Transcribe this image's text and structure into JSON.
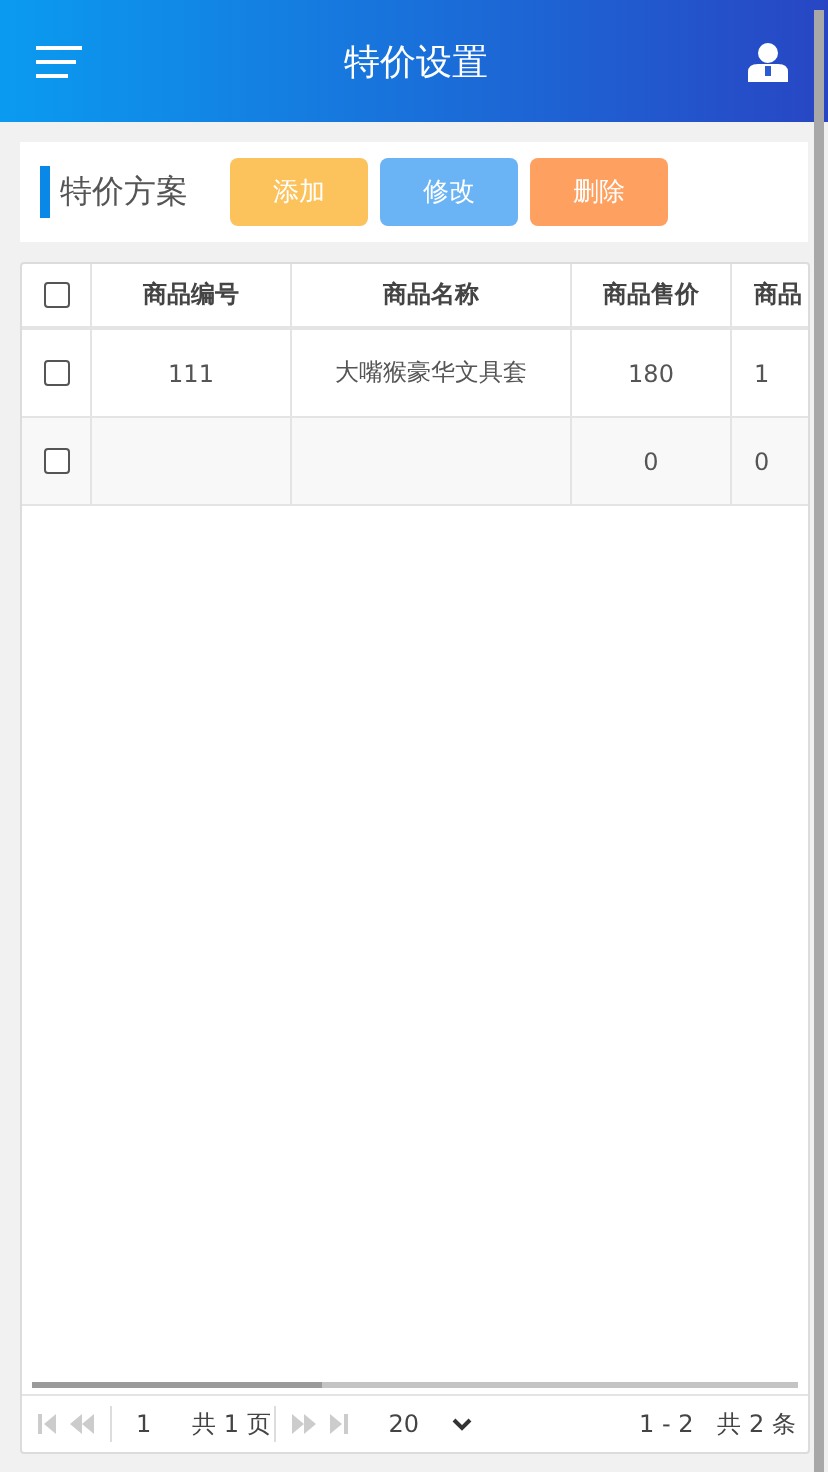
{
  "header": {
    "title": "特价设置"
  },
  "toolbar": {
    "title": "特价方案",
    "buttons": [
      {
        "label": "添加",
        "kind": "add"
      },
      {
        "label": "修改",
        "kind": "edit"
      },
      {
        "label": "删除",
        "kind": "delete"
      }
    ]
  },
  "table": {
    "header_checked": false,
    "columns": [
      "商品编号",
      "商品名称",
      "商品售价",
      "商品"
    ],
    "rows": [
      {
        "checked": false,
        "cells": [
          "111",
          "大嘴猴豪华文具套",
          "180",
          "1"
        ]
      },
      {
        "checked": false,
        "cells": [
          "",
          "",
          "0",
          "0"
        ]
      }
    ]
  },
  "pager": {
    "page": "1",
    "pages_text": "共 1 页",
    "page_size": "20",
    "range": "1 - 2",
    "total": "共 2 条"
  }
}
